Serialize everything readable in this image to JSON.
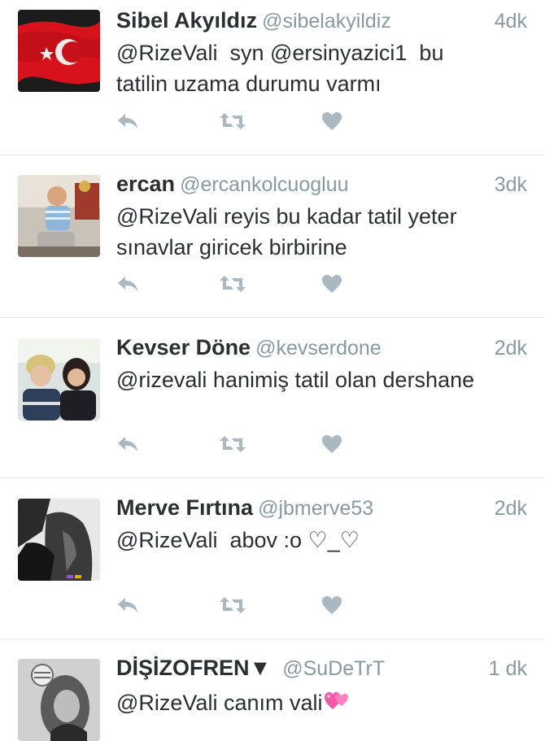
{
  "tweets": [
    {
      "name": "Sibel Akyıldız",
      "handle": "@sibelakyildiz",
      "time": "4dk",
      "text": "@RizeVali  syn @ersinyazici1  bu\ntatilin uzama durumu varmı",
      "avatar": "turkish-flag-avatar"
    },
    {
      "name": "ercan",
      "handle": "@ercankolcuogluu",
      "time": "3dk",
      "text": "@RizeVali reyis bu kadar tatil yeter\nsınavlar giricek birbirine",
      "avatar": "child-photo-avatar"
    },
    {
      "name": "Kevser Döne",
      "handle": "@kevserdone",
      "time": "2dk",
      "text": "@rizevali hanimiş tatil olan dershane",
      "avatar": "two-people-photo-avatar"
    },
    {
      "name": "Merve Fırtına",
      "handle": "@jbmerve53",
      "time": "2dk",
      "text": "@RizeVali  abov :o ♡_♡",
      "avatar": "bw-photo-avatar"
    },
    {
      "name": "DİŞİZOFREN▼",
      "handle": "@SuDeTrT",
      "time": "1 dk",
      "text": "@RizeVali canım vali",
      "avatar": "bw-girl-photo-avatar",
      "emoji": "pink-hearts-emoji"
    }
  ],
  "icons": {
    "reply": "reply-icon",
    "retweet": "retweet-icon",
    "like": "heart-icon"
  },
  "colors": {
    "name": "#292f33",
    "meta": "#8899a6",
    "action": "#aab8c2",
    "divider": "#e1e8ed"
  }
}
